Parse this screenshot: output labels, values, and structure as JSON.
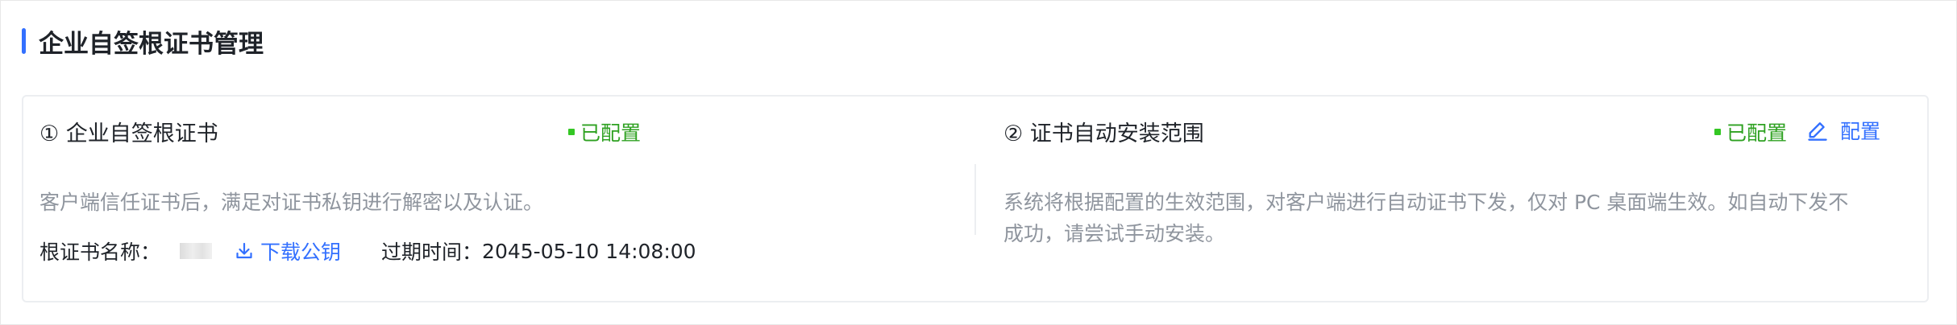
{
  "section": {
    "title": "企业自签根证书管理"
  },
  "left_panel": {
    "title": "① 企业自签根证书",
    "status": "已配置",
    "description": "客户端信任证书后，满足对证书私钥进行解密以及认证。",
    "cert_name_label": "根证书名称：",
    "download_label": "下载公钥",
    "expire_label": "过期时间：",
    "expire_value": "2045-05-10 14:08:00"
  },
  "right_panel": {
    "title": "② 证书自动安装范围",
    "status": "已配置",
    "config_label": "配置",
    "description_line1": "系统将根据配置的生效范围，对客户端进行自动证书下发，仅对 PC 桌面端生效。如自动下发不",
    "description_line2": "成功，请尝试手动安装。"
  },
  "colors": {
    "accent": "#3370ff",
    "status_green": "#2ea121",
    "text_primary": "#1f2329",
    "text_secondary": "#8f959e"
  },
  "icons": {
    "download": "download-icon",
    "edit": "edit-icon",
    "status": "status-dot-icon"
  }
}
